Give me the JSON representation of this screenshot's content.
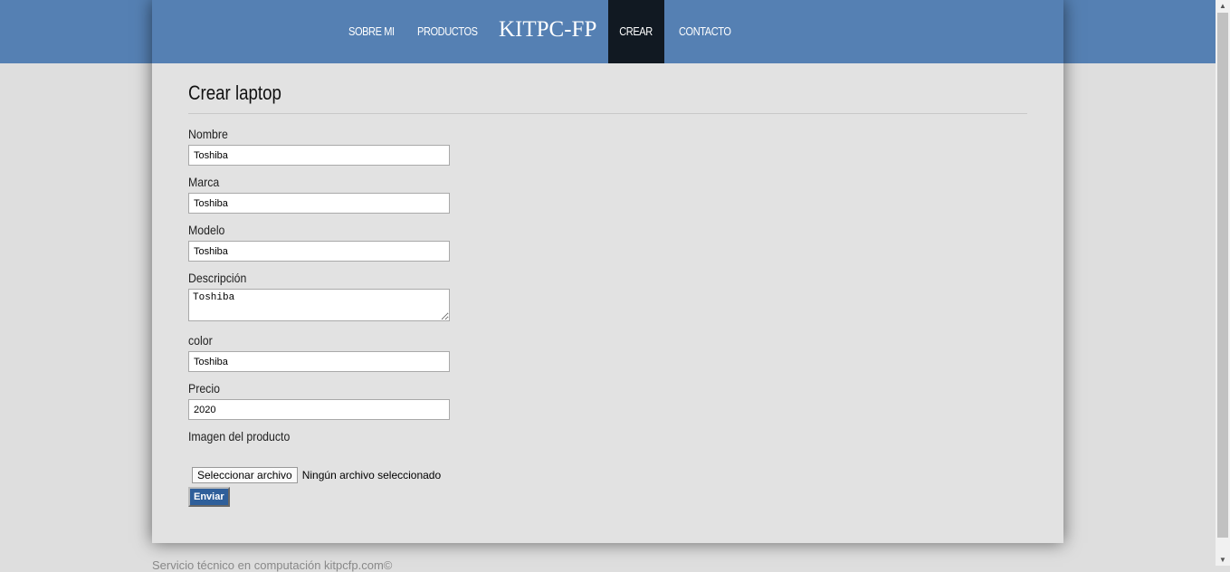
{
  "nav": {
    "items": [
      "SOBRE MI",
      "PRODUCTOS"
    ],
    "brand": "KITPC-FP",
    "active": "CREAR",
    "contact": "CONTACTO"
  },
  "page": {
    "title": "Crear laptop"
  },
  "form": {
    "nombre": {
      "label": "Nombre",
      "value": "Toshiba"
    },
    "marca": {
      "label": "Marca",
      "value": "Toshiba"
    },
    "modelo": {
      "label": "Modelo",
      "value": "Toshiba"
    },
    "descripcion": {
      "label": "Descripción",
      "value": "Toshiba"
    },
    "color": {
      "label": "color",
      "value": "Toshiba"
    },
    "precio": {
      "label": "Precio",
      "value": "2020"
    },
    "imagen": {
      "label": "Imagen del producto",
      "button": "Seleccionar archivo",
      "status": "Ningún archivo seleccionado"
    },
    "submit": "Enviar"
  },
  "footer": "Servicio técnico en computación kitpcfp.com©"
}
